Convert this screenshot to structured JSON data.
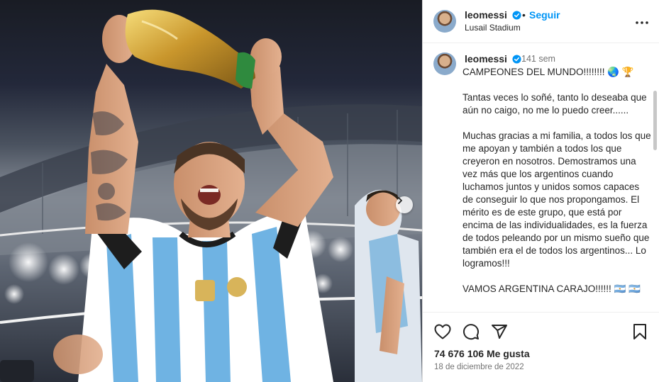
{
  "post": {
    "username": "leomessi",
    "follow_label": "Seguir",
    "separator": "•",
    "location": "Lusail Stadium"
  },
  "caption": {
    "username": "leomessi",
    "time_ago": "141 sem",
    "text": "CAMPEONES DEL MUNDO!!!!!!!! 🌏 🏆\n\nTantas veces lo soñé, tanto lo deseaba que aún no caigo, no me lo puedo creer......\n\nMuchas gracias a mi familia, a todos los que me apoyan y también a todos los que creyeron en nosotros. Demostramos una vez más que los argentinos cuando luchamos juntos y unidos somos capaces de conseguir lo que nos propongamos. El mérito es de este grupo, que está por encima de las individualidades, es la fuerza de todos peleando por un mismo sueño que también era el de todos los argentinos... Lo logramos!!!\n\nVAMOS ARGENTINA CARAJO!!!!!! 🇦🇷 🇦🇷"
  },
  "footer": {
    "likes": "74 676 106 Me gusta",
    "date": "18 de diciembre de 2022"
  },
  "icons": {
    "verified": "verified-badge-icon",
    "more": "more-horizontal-icon",
    "like": "heart-icon",
    "comment": "comment-icon",
    "share": "share-icon",
    "save": "bookmark-icon",
    "next": "chevron-right-icon"
  },
  "colors": {
    "accent": "#0095f6",
    "text": "#262626",
    "muted": "#737373",
    "border": "#dbdbdb"
  }
}
